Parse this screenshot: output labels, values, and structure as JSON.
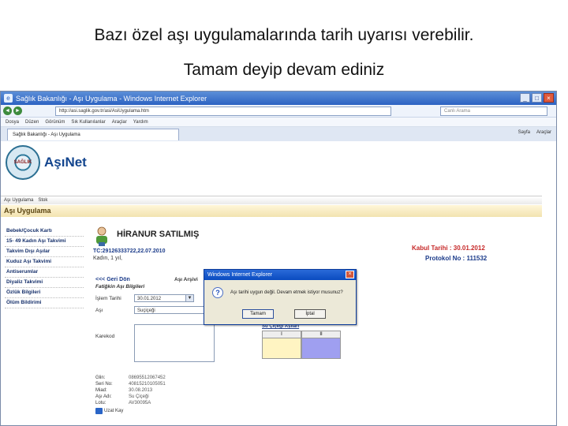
{
  "caption": {
    "line1": "Bazı özel aşı uygulamalarında tarih uyarısı verebilir.",
    "line2": "Tamam deyip devam ediniz"
  },
  "browser": {
    "title": "Sağlık Bakanlığı - Aşı Uygulama - Windows Internet Explorer",
    "address": "http://asi.saglik.gov.tr/asi/AsiUygulama.htm",
    "search_placeholder": "Canlı Arama",
    "menu": [
      "Dosya",
      "Düzen",
      "Görünüm",
      "Sık Kullanılanlar",
      "Araçlar",
      "Yardım"
    ],
    "tab": "Sağlık Bakanlığı - Aşı Uygulama",
    "tools": [
      "Sayfa",
      "Araçlar"
    ]
  },
  "app": {
    "brand": "AşıNet",
    "logo_text": "SAĞLIK",
    "nav": [
      "Aşı Uygulama",
      "Stok"
    ],
    "section_title": "Aşı Uygulama",
    "sidebar": [
      "Bebek/Çocuk Kartı",
      "15- 49 Kadın Aşı Takvimi",
      "Takvim Dışı Aşılar",
      "Kuduz Aşı Takvimi",
      "Antiserumlar",
      "Diyaliz Takvimi",
      "Özlük Bilgileri",
      "Ölüm Bildirimi"
    ],
    "patient": {
      "name": "HİRANUR SATILMIŞ",
      "id_line": "TC:29126333722,22.07.2010",
      "gender_line": "Kadın, 1 yıl,",
      "accept": "Kabul Tarihi : 30.01.2012",
      "protocol": "Protokol No : 111532"
    },
    "panel": {
      "back": "<<< Geri Dön",
      "archive": "Aşı Arşivi",
      "subtitle": "Fatiğkin Aşı Bilgileri",
      "date_label": "İşlem Tarihi",
      "date_value": "30.01.2012",
      "vaccine_label": "Aşı",
      "vaccine_value": "Suçiçeği",
      "notes_label": "Karekod",
      "grid_head": "Su Çiçeği Aşıları",
      "grid_cols": [
        "I",
        "II"
      ],
      "info": [
        {
          "k": "Glin:",
          "v": "08695512067452"
        },
        {
          "k": "Seri No:",
          "v": "40815210105051"
        },
        {
          "k": "Miad:",
          "v": "30.08.2013"
        },
        {
          "k": "Aşı Adı:",
          "v": "Su Çiçeği"
        },
        {
          "k": "Lotu:",
          "v": "AV30095A"
        }
      ],
      "save": "Uzat Kay"
    }
  },
  "dialog": {
    "title": "Windows Internet Explorer",
    "message": "Aşı tarihi uygun değil. Devam etmek istiyor musunuz?",
    "ok": "Tamam",
    "cancel": "İptal"
  }
}
